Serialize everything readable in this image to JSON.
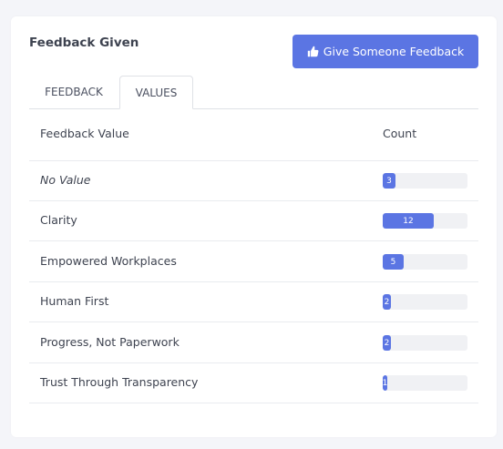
{
  "card": {
    "title": "Feedback Given",
    "action_button": {
      "label": "Give Someone Feedback",
      "icon": "thumbs-up-icon"
    }
  },
  "tabs": [
    {
      "label": "FEEDBACK",
      "active": false
    },
    {
      "label": "VALUES",
      "active": true
    }
  ],
  "table": {
    "columns": [
      "Feedback Value",
      "Count"
    ],
    "max_count": 20,
    "rows": [
      {
        "value": "No Value",
        "count": 3,
        "count_label": "3",
        "italic": true
      },
      {
        "value": "Clarity",
        "count": 12,
        "count_label": "12",
        "italic": false
      },
      {
        "value": "Empowered Workplaces",
        "count": 5,
        "count_label": "5",
        "italic": false
      },
      {
        "value": "Human First",
        "count": 2,
        "count_label": "2",
        "italic": false
      },
      {
        "value": "Progress, Not Paperwork",
        "count": 2,
        "count_label": "2",
        "italic": false
      },
      {
        "value": "Trust Through Transparency",
        "count": 1,
        "count_label": "1",
        "italic": false
      }
    ]
  },
  "colors": {
    "accent": "#5b75e3",
    "bar_track": "#f0f1f4",
    "page_background": "#f4f5f9"
  }
}
